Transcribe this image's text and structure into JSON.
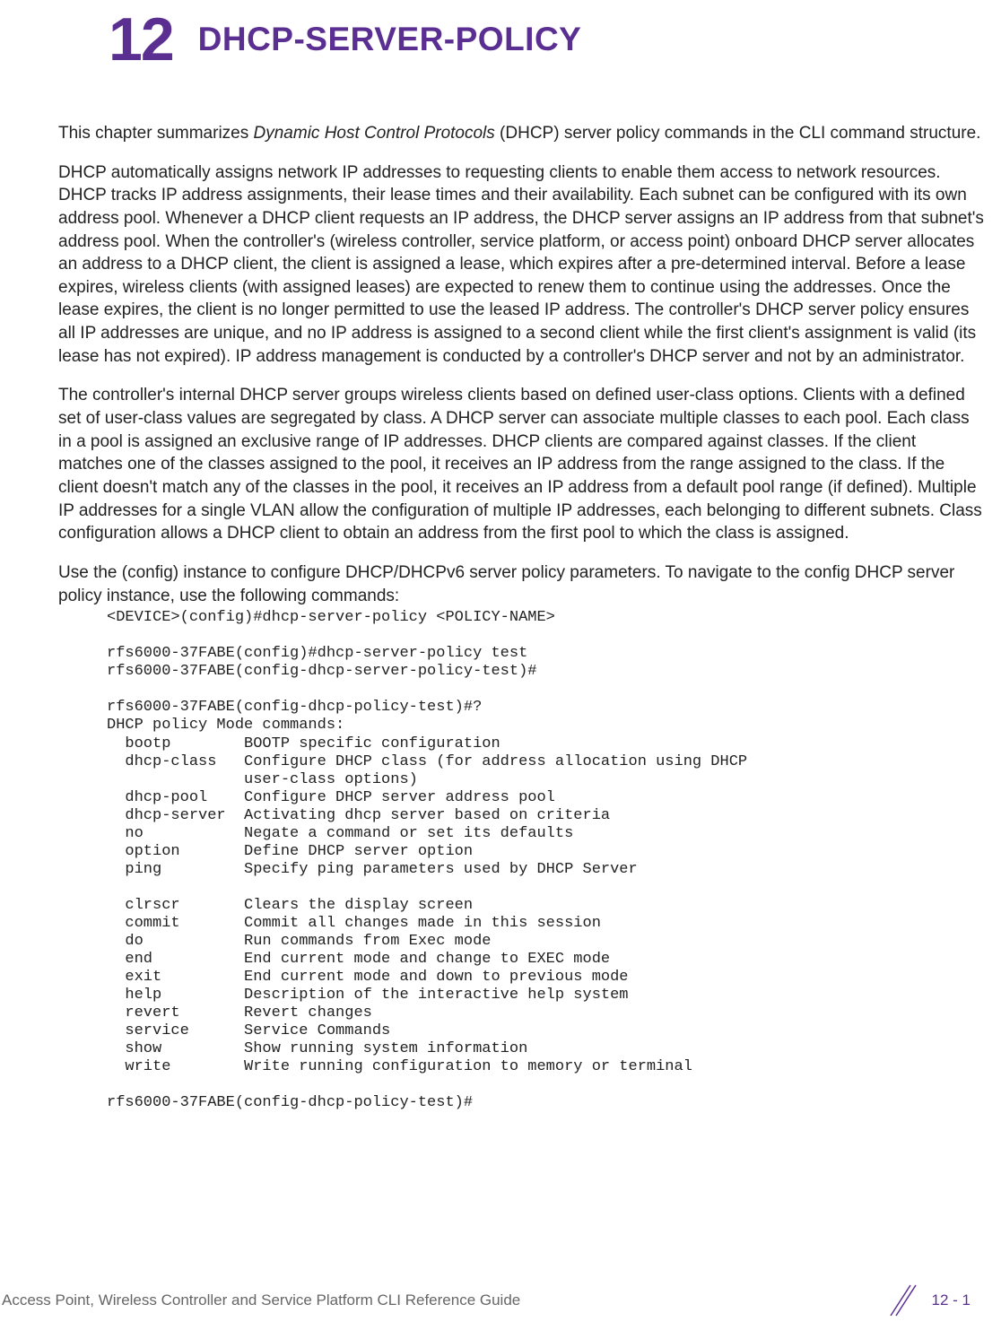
{
  "header": {
    "chapter_number": "12",
    "chapter_title": "DHCP-SERVER-POLICY"
  },
  "paragraphs": {
    "p1_pre": "This chapter summarizes ",
    "p1_em": "Dynamic Host Control Protocols",
    "p1_post": " (DHCP) server policy commands in the CLI command structure.",
    "p2": "DHCP automatically assigns network IP addresses to requesting clients to enable them access to network resources. DHCP tracks IP address assignments, their lease times and their availability. Each subnet can be configured with its own address pool. Whenever a DHCP client requests an IP address, the DHCP server assigns an IP address from that subnet's address pool. When the controller's (wireless controller, service platform, or access point) onboard DHCP server allocates an address to a DHCP client, the client is assigned a lease, which expires after a pre-determined interval. Before a lease expires, wireless clients (with assigned leases) are expected to renew them to continue using the addresses. Once the lease expires, the client is no longer permitted to use the leased IP address. The controller's DHCP server policy ensures all IP addresses are unique, and no IP address is assigned to a second client while the first client's assignment is valid (its lease has not expired). IP address management is conducted by a controller's DHCP server and not by an administrator.",
    "p3": "The controller's internal DHCP server groups wireless clients based on defined user-class options. Clients with a defined set of user-class values are segregated by class. A DHCP server can associate multiple classes to each pool. Each class in a pool is assigned an exclusive range of IP addresses. DHCP clients are compared against classes. If the client matches one of the classes assigned to the pool, it receives an IP address from the range assigned to the class. If the client doesn't match any of the classes in the pool, it receives an IP address from a default pool range (if defined). Multiple IP addresses for a single VLAN allow the configuration of multiple IP addresses, each belonging to different subnets. Class configuration allows a DHCP client to obtain an address from the first pool to which the class is assigned.",
    "p4": "Use the (config) instance to configure DHCP/DHCPv6 server policy parameters. To navigate to the config DHCP server policy instance, use the following commands:"
  },
  "code": "<DEVICE>(config)#dhcp-server-policy <POLICY-NAME>\n\nrfs6000-37FABE(config)#dhcp-server-policy test\nrfs6000-37FABE(config-dhcp-server-policy-test)#\n\nrfs6000-37FABE(config-dhcp-policy-test)#?\nDHCP policy Mode commands:\n  bootp        BOOTP specific configuration\n  dhcp-class   Configure DHCP class (for address allocation using DHCP\n               user-class options)\n  dhcp-pool    Configure DHCP server address pool\n  dhcp-server  Activating dhcp server based on criteria\n  no           Negate a command or set its defaults\n  option       Define DHCP server option\n  ping         Specify ping parameters used by DHCP Server\n\n  clrscr       Clears the display screen\n  commit       Commit all changes made in this session\n  do           Run commands from Exec mode\n  end          End current mode and change to EXEC mode\n  exit         End current mode and down to previous mode\n  help         Description of the interactive help system\n  revert       Revert changes\n  service      Service Commands\n  show         Show running system information\n  write        Write running configuration to memory or terminal\n\nrfs6000-37FABE(config-dhcp-policy-test)#",
  "footer": {
    "left": "Access Point, Wireless Controller and Service Platform CLI Reference Guide",
    "right": "12 - 1"
  }
}
